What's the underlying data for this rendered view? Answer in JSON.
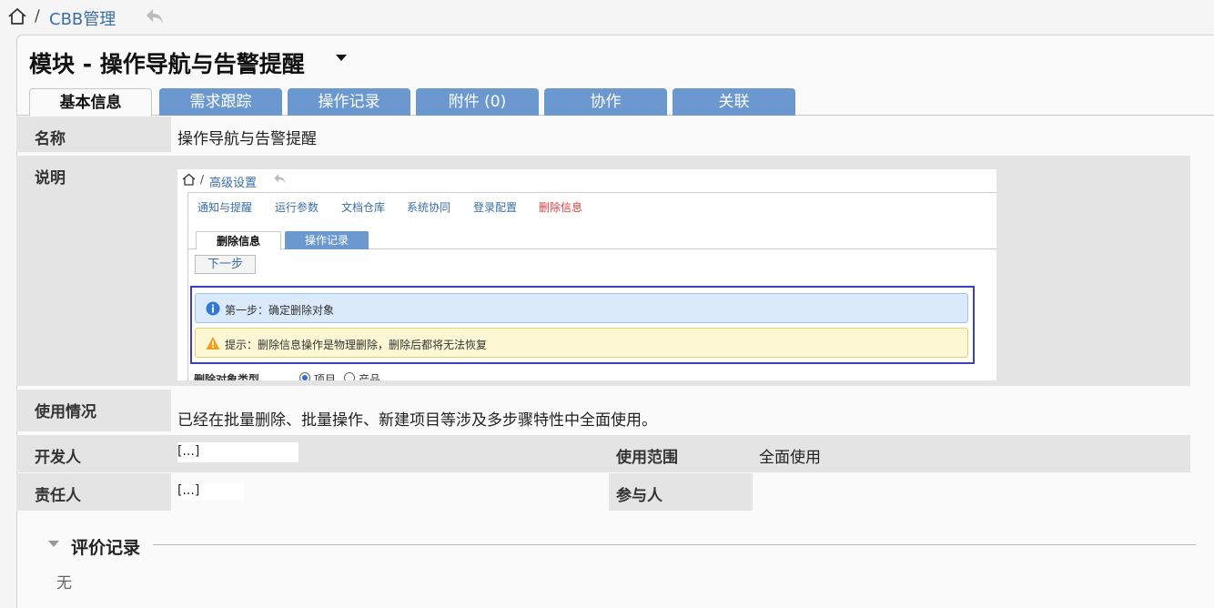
{
  "breadcrumb": {
    "separator": "/",
    "current": "CBB管理"
  },
  "page": {
    "title": "模块 - 操作导航与告警提醒"
  },
  "tabs": [
    "基本信息",
    "需求跟踪",
    "操作记录",
    "附件 (0)",
    "协作",
    "关联"
  ],
  "fields": {
    "name_label": "名称",
    "name_value": "操作导航与告警提醒",
    "desc_label": "说明",
    "usage_label": "使用情况",
    "usage_value": "已经在批量删除、批量操作、新建项目等涉及多步骤特性中全面使用。",
    "developer_label": "开发人",
    "developer_value": "[...]",
    "scope_label": "使用范围",
    "scope_value": "全面使用",
    "owner_label": "责任人",
    "owner_value": "[...]",
    "participant_label": "参与人",
    "participant_value": ""
  },
  "screenshot": {
    "breadcrumb": {
      "separator": "/",
      "current": "高级设置"
    },
    "nav": [
      "通知与提醒",
      "运行参数",
      "文档仓库",
      "系统协同",
      "登录配置",
      "删除信息"
    ],
    "tabs": [
      "删除信息",
      "操作记录"
    ],
    "next_button": "下一步",
    "info_text": "第一步：确定删除对象",
    "warn_text": "提示：删除信息操作是物理删除，删除后都将无法恢复",
    "type_label": "删除对象类型",
    "radio_options": [
      "项目",
      "产品"
    ]
  },
  "comments": {
    "title": "评价记录",
    "empty": "无"
  },
  "colors": {
    "tab_blue": "#6b98cf",
    "link": "#3a6ea5",
    "highlight": "#3b3fc0",
    "alert_red": "#e03c3c"
  }
}
